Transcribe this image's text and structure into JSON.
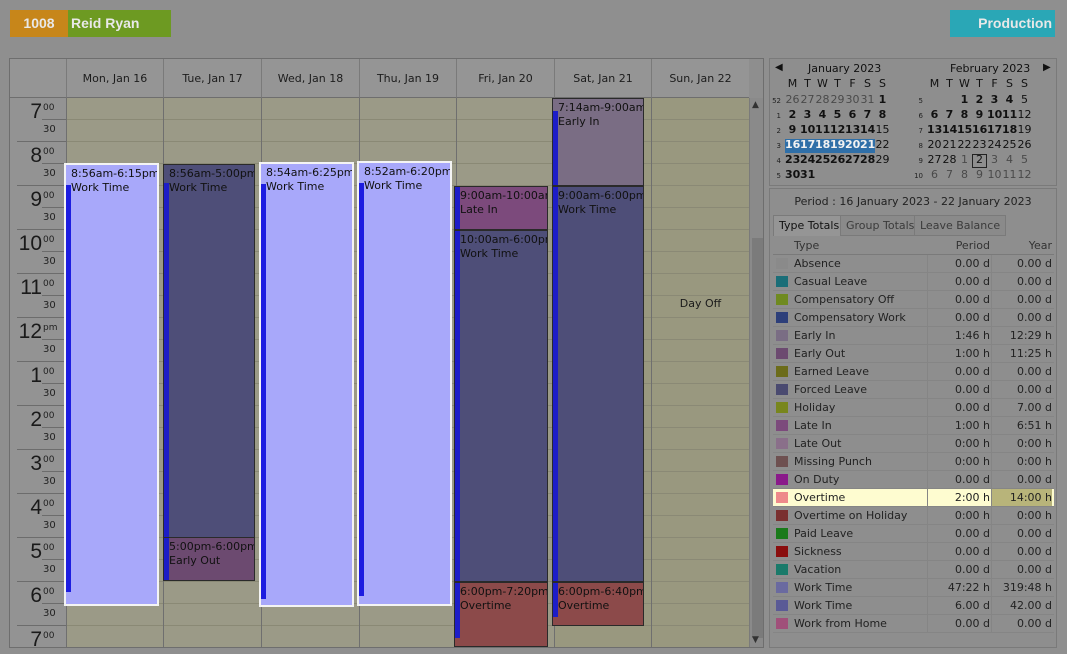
{
  "employee": {
    "id": "1008",
    "name": "Reid Ryan",
    "department": "Production"
  },
  "days": [
    {
      "label": "Mon, Jan 16"
    },
    {
      "label": "Tue, Jan 17"
    },
    {
      "label": "Wed, Jan 18"
    },
    {
      "label": "Thu, Jan 19"
    },
    {
      "label": "Fri, Jan 20"
    },
    {
      "label": "Sat, Jan 21"
    },
    {
      "label": "Sun, Jan 22"
    }
  ],
  "hours": [
    {
      "h": "7",
      "s": "00"
    },
    {
      "h": "8",
      "s": "00"
    },
    {
      "h": "9",
      "s": "00"
    },
    {
      "h": "10",
      "s": "00"
    },
    {
      "h": "11",
      "s": "00"
    },
    {
      "h": "12",
      "s": "pm"
    },
    {
      "h": "1",
      "s": "00"
    },
    {
      "h": "2",
      "s": "00"
    },
    {
      "h": "3",
      "s": "00"
    },
    {
      "h": "4",
      "s": "00"
    },
    {
      "h": "5",
      "s": "00"
    },
    {
      "h": "6",
      "s": "00"
    },
    {
      "h": "7",
      "s": "00"
    }
  ],
  "half_label": "30",
  "day_off_label": "Day Off",
  "appointments": [
    {
      "time": "8:56am-6:15pm",
      "label": "Work Time"
    },
    {
      "time": "8:56am-5:00pm",
      "label": "Work Time"
    },
    {
      "time": "5:00pm-6:00pm",
      "label": "Early Out"
    },
    {
      "time": "8:54am-6:25pm",
      "label": "Work Time"
    },
    {
      "time": "8:52am-6:20pm",
      "label": "Work Time"
    },
    {
      "time": "9:00am-10:00am",
      "label": "Late In"
    },
    {
      "time": "10:00am-6:00pm",
      "label": "Work Time"
    },
    {
      "time": "6:00pm-7:20pm",
      "label": "Overtime"
    },
    {
      "time": "7:14am-9:00am",
      "label": "Early In"
    },
    {
      "time": "9:00am-6:00pm",
      "label": "Work Time"
    },
    {
      "time": "6:00pm-6:40pm",
      "label": "Overtime"
    }
  ],
  "minicals": {
    "jan": {
      "title": "January 2023"
    },
    "feb": {
      "title": "February 2023"
    },
    "weekdays": [
      "M",
      "T",
      "W",
      "T",
      "F",
      "S",
      "S"
    ]
  },
  "period": {
    "title": "Period : 16 January 2023 - 22 January 2023"
  },
  "tabs": [
    "Type Totals",
    "Group Totals",
    "Leave Balance"
  ],
  "table": {
    "headers": {
      "type": "Type",
      "period": "Period",
      "year": "Year"
    },
    "rows": [
      {
        "type": "Absence",
        "period": "0.00 d",
        "year": "0.00 d",
        "color": "#8a8a8a"
      },
      {
        "type": "Casual Leave",
        "period": "0.00 d",
        "year": "0.00 d",
        "color": "#1b6e78"
      },
      {
        "type": "Compensatory Off",
        "period": "0.00 d",
        "year": "0.00 d",
        "color": "#6f8a20"
      },
      {
        "type": "Compensatory Work",
        "period": "0.00 d",
        "year": "0.00 d",
        "color": "#2d3f7a"
      },
      {
        "type": "Early In",
        "period": "1:46 h",
        "year": "12:29 h",
        "color": "#7a6d84"
      },
      {
        "type": "Early Out",
        "period": "1:00 h",
        "year": "11:25 h",
        "color": "#6c4a70"
      },
      {
        "type": "Earned Leave",
        "period": "0.00 d",
        "year": "0.00 d",
        "color": "#6c6c1a"
      },
      {
        "type": "Forced Leave",
        "period": "0.00 d",
        "year": "0.00 d",
        "color": "#4a4a70"
      },
      {
        "type": "Holiday",
        "period": "0.00 d",
        "year": "7.00 d",
        "color": "#78861d"
      },
      {
        "type": "Late In",
        "period": "1:00 h",
        "year": "6:51 h",
        "color": "#7c4a7c"
      },
      {
        "type": "Late Out",
        "period": "0:00 h",
        "year": "0:00 h",
        "color": "#8a6f8a"
      },
      {
        "type": "Missing Punch",
        "period": "0:00 h",
        "year": "0:00 h",
        "color": "#6e5050"
      },
      {
        "type": "On Duty",
        "period": "0.00 d",
        "year": "0.00 d",
        "color": "#8a1a8a"
      },
      {
        "type": "Overtime",
        "period": "2:00 h",
        "year": "14:00 h",
        "color": "#ee8a8a"
      },
      {
        "type": "Overtime on Holiday",
        "period": "0:00 h",
        "year": "0:00 h",
        "color": "#7a3030"
      },
      {
        "type": "Paid Leave",
        "period": "0.00 d",
        "year": "0.00 d",
        "color": "#1a7a1a"
      },
      {
        "type": "Sickness",
        "period": "0.00 d",
        "year": "0.00 d",
        "color": "#8a0e0e"
      },
      {
        "type": "Vacation",
        "period": "0.00 d",
        "year": "0.00 d",
        "color": "#1a7a6a"
      },
      {
        "type": "Work Time",
        "period": "47:22 h",
        "year": "319:48 h",
        "color": "#6a6aa0"
      },
      {
        "type": "Work Time",
        "period": "6.00 d",
        "year": "42.00 d",
        "color": "#5a5a96"
      },
      {
        "type": "Work from Home",
        "period": "0.00 d",
        "year": "0.00 d",
        "color": "#a0507a"
      }
    ]
  }
}
